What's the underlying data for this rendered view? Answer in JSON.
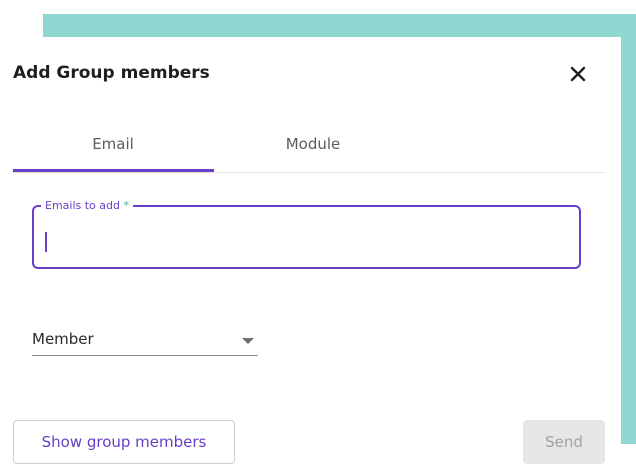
{
  "dialog": {
    "title": "Add Group members",
    "close_icon": "close-icon"
  },
  "tabs": [
    {
      "label": "Email",
      "active": true
    },
    {
      "label": "Module",
      "active": false
    }
  ],
  "email_field": {
    "label": "Emails to add",
    "required_marker": "*",
    "value": ""
  },
  "role_select": {
    "value": "Member",
    "icon": "dropdown-arrow-icon"
  },
  "footer": {
    "show_members_label": "Show group members",
    "send_label": "Send",
    "send_disabled": true
  },
  "colors": {
    "accent": "#6a3fc8",
    "backdrop": "#8fd8d2",
    "required": "#4aa9a0",
    "disabled_bg": "#e6e6e6"
  }
}
